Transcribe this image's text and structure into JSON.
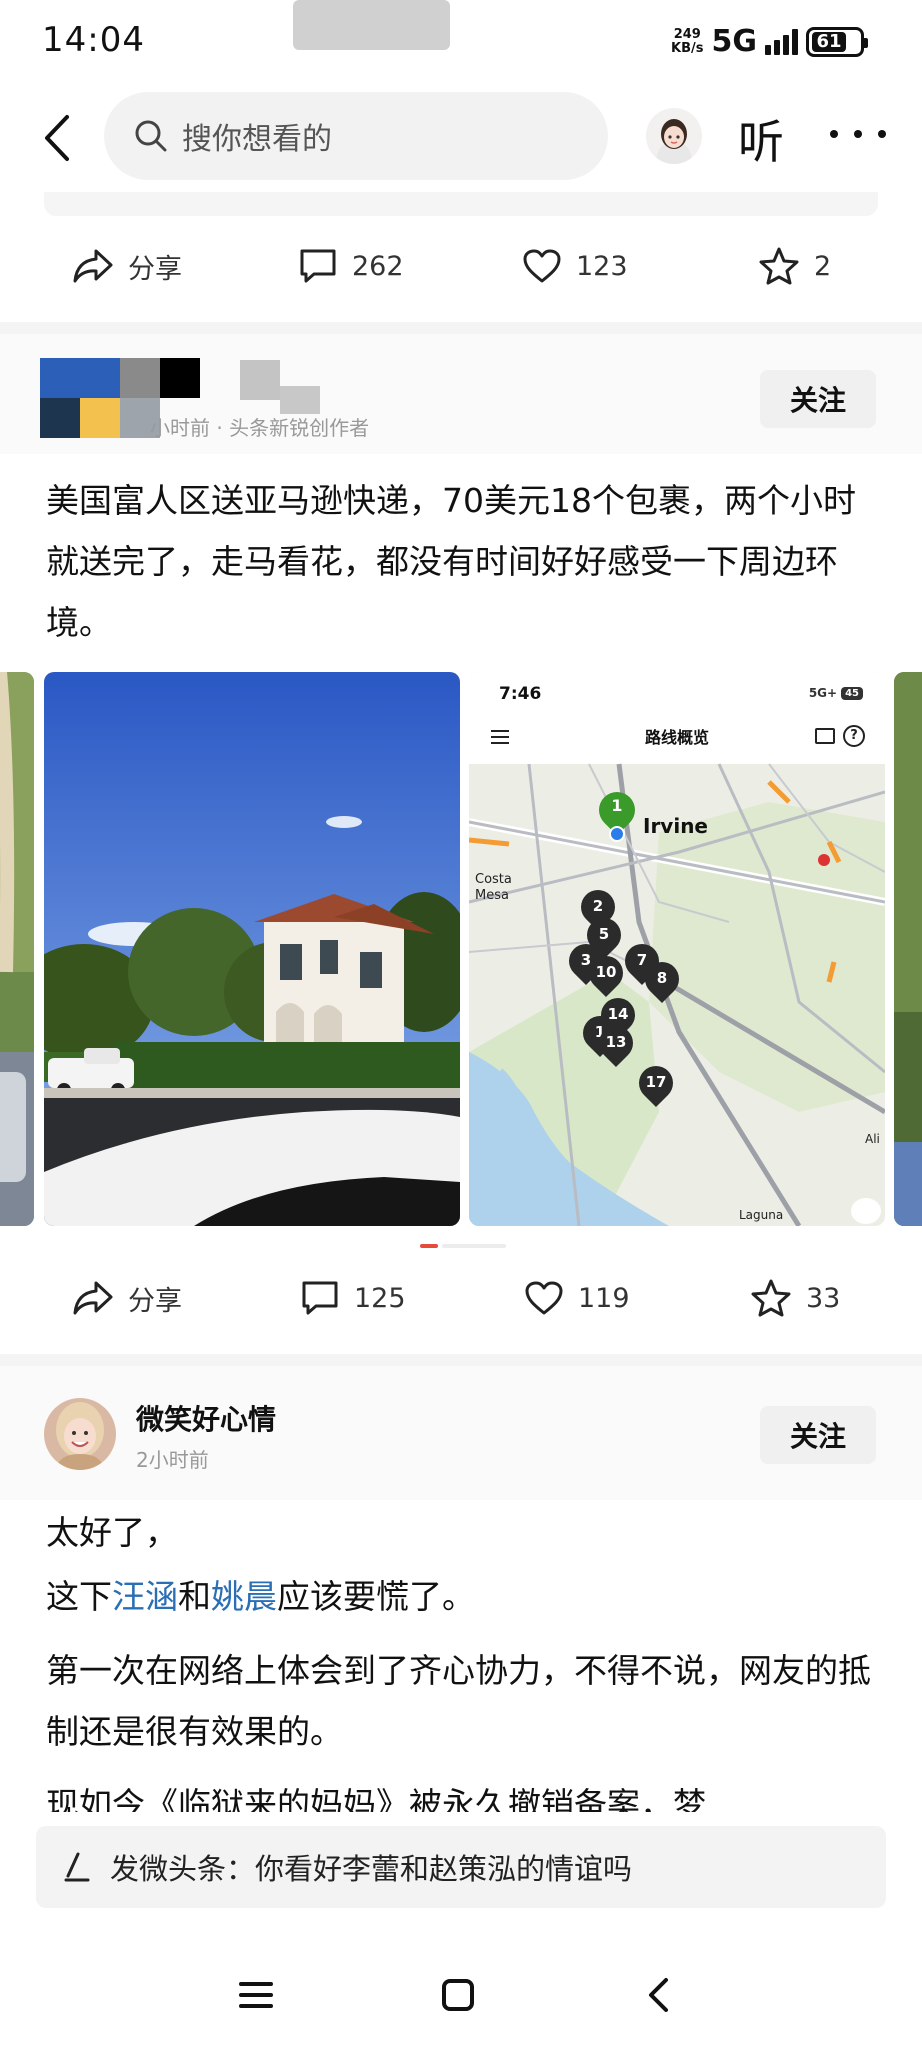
{
  "status_bar": {
    "time": "14:04",
    "net_speed_top": "249",
    "net_speed_bottom": "KB/s",
    "network": "5G",
    "battery": "61"
  },
  "header": {
    "search_placeholder": "搜你想看的",
    "listen_label": "听",
    "icons": [
      "back-arrow-icon",
      "search-icon",
      "avatar",
      "more-icon"
    ]
  },
  "post1_actions": {
    "share_label": "分享",
    "comments": "262",
    "likes": "123",
    "favorites": "2"
  },
  "post2": {
    "meta": "小时前 · 头条新锐创作者",
    "follow_label": "关注",
    "text": "美国富人区送亚马逊快递，70美元18个包裹，两个小时就送完了，走马看花，都没有时间好好感受一下周边环境。",
    "map": {
      "time": "7:46",
      "title": "路线概览",
      "status_right": "5G+",
      "battery": "45",
      "city_label": "Irvine",
      "place_labels": [
        "Costa",
        "Mesa",
        "Laguna",
        "Ali"
      ],
      "pins": [
        "1",
        "2",
        "5",
        "3",
        "10",
        "7",
        "8",
        "14",
        "1",
        "13",
        "17"
      ]
    },
    "actions": {
      "share_label": "分享",
      "comments": "125",
      "likes": "119",
      "favorites": "33"
    }
  },
  "post3": {
    "author": "微笑好心情",
    "time": "2小时前",
    "follow_label": "关注",
    "line1": "太好了，",
    "line2_prefix": "这下",
    "link1": "汪涵",
    "line2_mid": "和",
    "link2": "姚晨",
    "line2_suffix": "应该要慌了。",
    "para2": "第一次在网络上体会到了齐心协力，不得不说，网友的抵制还是很有效果的。",
    "para3_cut": "现如今《临狱来的妈妈》被永久撤销备案，梦"
  },
  "compose": {
    "prompt": "发微头条：你看好李蕾和赵策泓的情谊吗"
  },
  "colors": {
    "link": "#2a6fb5",
    "map_green_pin": "#3a9a2a",
    "map_blue_dot": "#2b7de9",
    "indicator_active": "#e64a3b"
  }
}
